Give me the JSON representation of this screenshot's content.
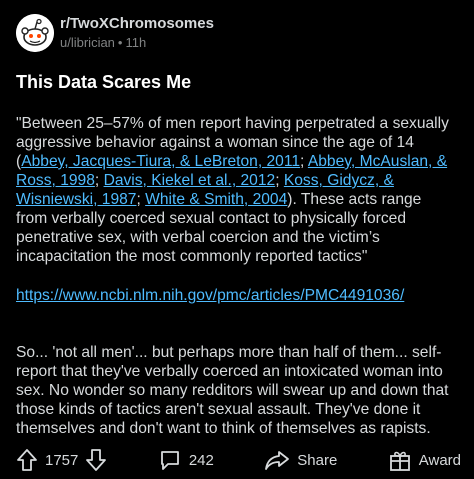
{
  "post": {
    "subreddit": "r/TwoXChromosomes",
    "user": "u/librician",
    "time": "11h",
    "title": "This Data Scares Me",
    "p1_a": "\"Between 25–57% of men report having perpetrated a sexually aggressive behavior against a woman since the age of 14 (",
    "ref1": "Abbey, Jacques-Tiura, & LeBreton, 2011",
    "sep": "; ",
    "ref2": "Abbey, McAuslan, & Ross, 1998",
    "ref3": "Davis, Kiekel et al., 2012",
    "ref4": "Koss, Gidycz, & Wisniewski, 1987",
    "ref5": "White & Smith, 2004",
    "p1_b": "). These acts range from verbally coerced sexual contact to physically forced penetrative sex, with verbal coercion and the victim’s incapacitation the most commonly reported tactics\"",
    "url": "https://www.ncbi.nlm.nih.gov/pmc/articles/PMC4491036/",
    "p2": "So... 'not all men'... but perhaps more than half of them... self-report that they've verbally coerced an intoxicated woman into sex. No wonder so many redditors will swear up and down that those kinds of tactics aren't sexual assault. They've done it themselves and don't want to think of themselves as rapists."
  },
  "actions": {
    "votes": "1757",
    "comments": "242",
    "share": "Share",
    "award": "Award"
  },
  "icons": {
    "avatar": "reddit-snoo-icon",
    "upvote": "upvote-arrow-icon",
    "downvote": "downvote-arrow-icon",
    "comment": "comment-bubble-icon",
    "share": "share-arrow-icon",
    "award": "award-gift-icon"
  },
  "colors": {
    "background": "#000000",
    "text": "#d7dadc",
    "muted": "#818384",
    "link": "#4fbcff"
  }
}
